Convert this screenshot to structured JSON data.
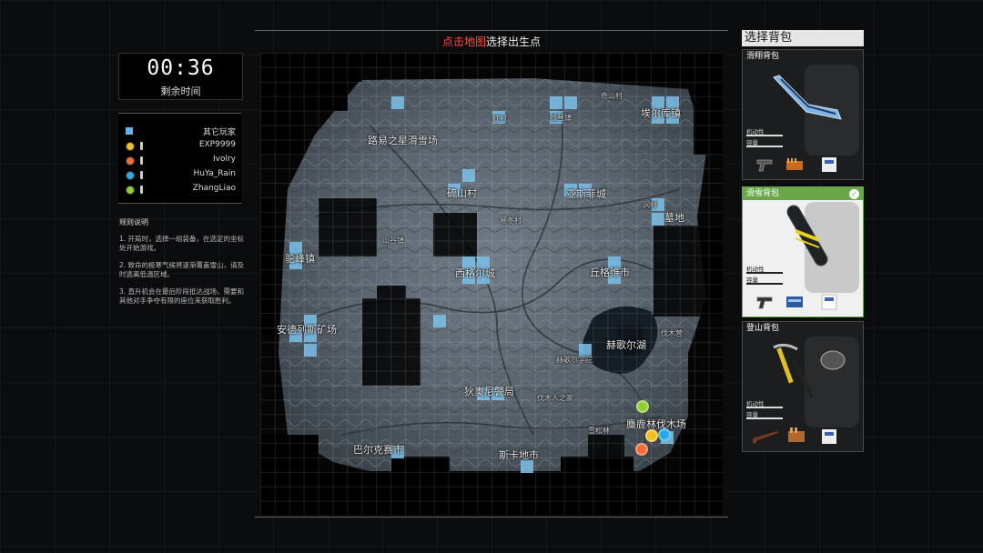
{
  "timer": {
    "value": "00:36",
    "label": "剩余时间"
  },
  "players": {
    "header": "其它玩家",
    "list": [
      {
        "name": "EXP9999",
        "color": "#f0c020"
      },
      {
        "name": "Ivolry",
        "color": "#f06a3a"
      },
      {
        "name": "HuYa_Rain",
        "color": "#2aa9e6"
      },
      {
        "name": "ZhangLiao",
        "color": "#8ed12e"
      }
    ]
  },
  "rules": {
    "title": "规则说明",
    "items": [
      "1. 开局时，选择一组装备，在选定的坐标处开始游戏。",
      "2. 致命的极寒气候将逐渐覆盖雪山，请及时逃离低温区域。",
      "3. 直升机会在最后阶段抵达战场，需要和其他对手争夺有限的座位来获取胜利。"
    ]
  },
  "map": {
    "title_prefix": "点击地图",
    "title_suffix": "选择出生点",
    "labels": [
      {
        "name": "路易之星滑雪场"
      },
      {
        "name": "红村"
      },
      {
        "name": "银彗镇"
      },
      {
        "name": "奇山村"
      },
      {
        "name": "埃尔库镇"
      },
      {
        "name": "亚斯菲城"
      },
      {
        "name": "硫山村"
      },
      {
        "name": "墓地"
      },
      {
        "name": "洞村"
      },
      {
        "name": "寒冬村"
      },
      {
        "name": "山谷镇"
      },
      {
        "name": "西格尔城"
      },
      {
        "name": "丘格维市"
      },
      {
        "name": "驼峰镇"
      },
      {
        "name": "安德列斯矿场"
      },
      {
        "name": "赫歌尔湖"
      },
      {
        "name": "伐木营"
      },
      {
        "name": "赫歌尔学院"
      },
      {
        "name": "狄奥尼警局"
      },
      {
        "name": "伐木人之家"
      },
      {
        "name": "麋鹿林伐木场"
      },
      {
        "name": "雪松林"
      },
      {
        "name": "巴尔克赛市"
      },
      {
        "name": "斯卡地市"
      }
    ],
    "player_markers": [
      {
        "player": "ZhangLiao",
        "color": "#8ed12e"
      },
      {
        "player": "EXP9999",
        "color": "#f0c020"
      },
      {
        "player": "HuYa_Rain",
        "color": "#2aa9e6"
      },
      {
        "player": "Ivolry",
        "color": "#f06a3a"
      }
    ]
  },
  "backpacks": {
    "title": "选择背包",
    "cards": [
      {
        "name": "滑翔背包",
        "stat1": "机动性",
        "stat2": "容量",
        "selected": false,
        "items": [
          "pistol-icon",
          "ammo-box-icon",
          "medkit-icon"
        ]
      },
      {
        "name": "滑雪背包",
        "stat1": "机动性",
        "stat2": "容量",
        "selected": true,
        "items": [
          "pistol-icon",
          "ammo-box-icon",
          "medkit-icon"
        ]
      },
      {
        "name": "登山背包",
        "stat1": "机动性",
        "stat2": "容量",
        "selected": false,
        "items": [
          "rifle-icon",
          "ammo-box-icon",
          "medkit-icon"
        ]
      }
    ]
  }
}
